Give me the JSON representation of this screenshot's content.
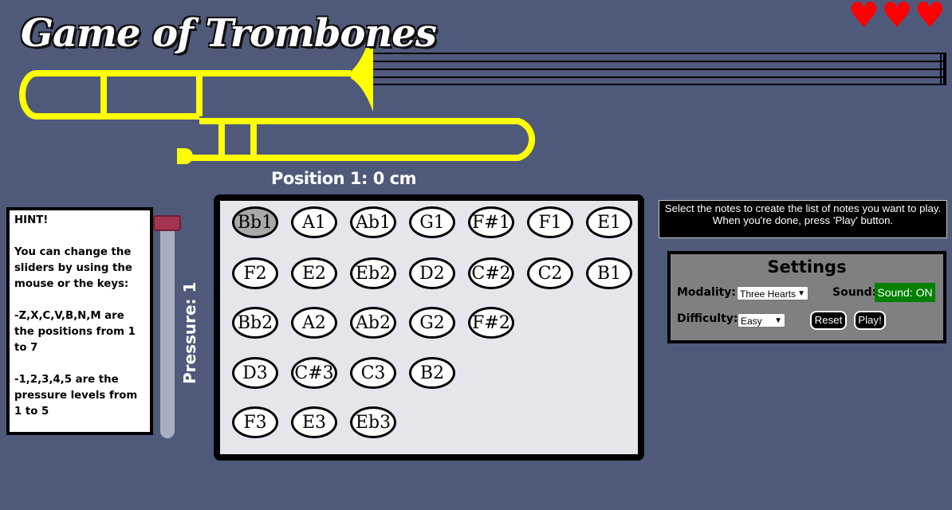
{
  "title": "Game of Trombones",
  "hearts": [
    "♥",
    "♥",
    "♥"
  ],
  "position_label": "Position 1: 0 cm",
  "hint": {
    "heading": "HINT!",
    "line1": "You can change the sliders by using the mouse or the keys:",
    "line2": "-Z,X,C,V,B,N,M are the positions from 1 to 7",
    "line3": "-1,2,3,4,5 are the pressure levels from 1 to 5"
  },
  "pressure_label": "Pressure: 1",
  "pressure_level": 1,
  "notes": [
    [
      "Bb1",
      "A1",
      "Ab1",
      "G1",
      "F#1",
      "F1",
      "E1"
    ],
    [
      "F2",
      "E2",
      "Eb2",
      "D2",
      "C#2",
      "C2",
      "B1"
    ],
    [
      "Bb2",
      "A2",
      "Ab2",
      "G2",
      "F#2"
    ],
    [
      "D3",
      "C#3",
      "C3",
      "B2"
    ],
    [
      "F3",
      "E3",
      "Eb3"
    ]
  ],
  "selected_note": "Bb1",
  "instructions": {
    "line1": "Select the notes to create the list of notes you want to play.",
    "line2": "When you're done, press 'Play' button."
  },
  "settings": {
    "title": "Settings",
    "modality_label": "Modality:",
    "modality_value": "Three Hearts",
    "sound_label": "Sound:",
    "sound_button": "Sound: ON",
    "difficulty_label": "Difficulty:",
    "difficulty_value": "Easy",
    "reset_button": "Reset",
    "play_button": "Play!"
  },
  "colors": {
    "background": "#4f5a7b",
    "trombone": "#ffff00",
    "heart": "#ff0000",
    "slider_thumb": "#a33452",
    "sound_on": "#008000"
  }
}
